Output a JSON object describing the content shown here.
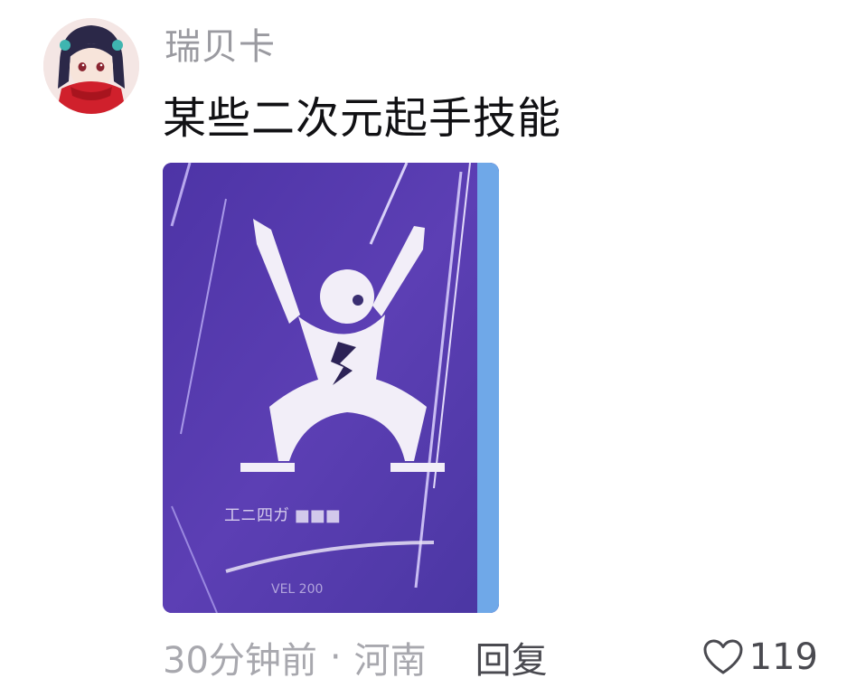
{
  "comment": {
    "username": "瑞贝卡",
    "text": "某些二次元起手技能",
    "image_caption_line1": "工ニ四ガ ■■■",
    "image_caption_line2": "VEL 200"
  },
  "meta": {
    "time": "30分钟前",
    "separator": "·",
    "location": "河南",
    "reply_label": "回复"
  },
  "likes": {
    "count": "119"
  },
  "colors": {
    "username": "#9a9aa0",
    "text": "#111114",
    "image_bg": "#5a3dad",
    "meta": "#a8a8ae",
    "action": "#4a4a50"
  },
  "icons": {
    "like": "heart-outline-icon",
    "avatar": "anime-girl-avatar"
  }
}
